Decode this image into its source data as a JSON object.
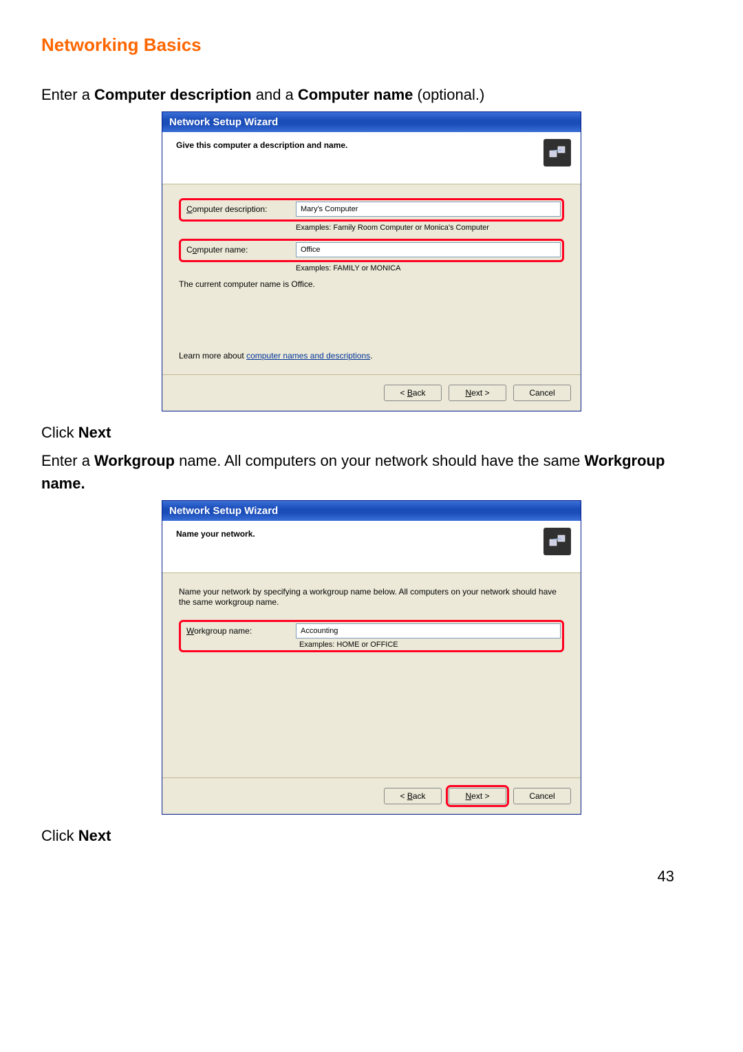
{
  "page_title": "Networking Basics",
  "intro1_parts": [
    "Enter a ",
    "Computer description",
    " and a ",
    "Computer name",
    " (optional.)"
  ],
  "dialog1": {
    "title": "Network Setup Wizard",
    "header": "Give this computer a description and name.",
    "desc_label": "Computer description:",
    "desc_value": "Mary's Computer",
    "desc_hint": "Examples: Family Room Computer or Monica's Computer",
    "name_label": "Computer name:",
    "name_value": "Office",
    "name_hint": "Examples: FAMILY or MONICA",
    "current_name_text": "The current computer name is Office.",
    "learn_prefix": "Learn more about ",
    "learn_link": "computer names and descriptions",
    "learn_suffix": ".",
    "back": "< Back",
    "next": "Next >",
    "cancel": "Cancel"
  },
  "click_next": [
    "Click ",
    "Next"
  ],
  "intro2_parts": [
    "Enter a ",
    "Workgroup",
    " name.  All computers on your network should have the same ",
    "Workgroup name."
  ],
  "dialog2": {
    "title": "Network Setup Wizard",
    "header": "Name your network.",
    "body_text": "Name your network by specifying a workgroup name below. All computers on your network should have the same workgroup name.",
    "wg_label": "Workgroup name:",
    "wg_value": "Accounting",
    "wg_hint": "Examples: HOME or OFFICE",
    "back": "< Back",
    "next": "Next >",
    "cancel": "Cancel"
  },
  "page_number": "43"
}
